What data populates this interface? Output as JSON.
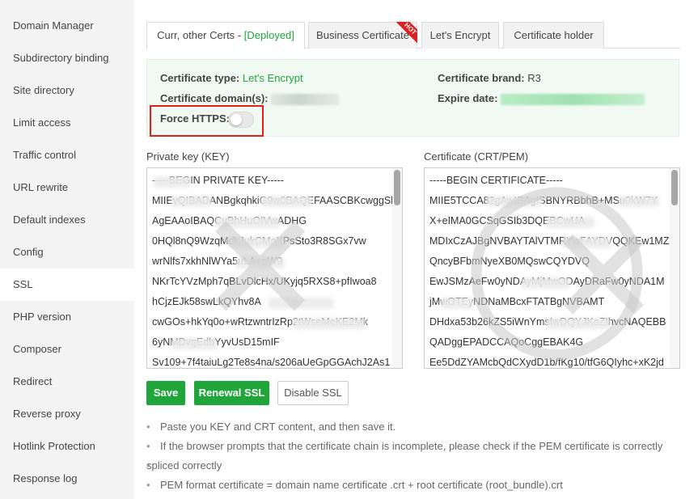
{
  "sidebar": {
    "items": [
      {
        "label": "Domain Manager"
      },
      {
        "label": "Subdirectory binding"
      },
      {
        "label": "Site directory"
      },
      {
        "label": "Limit access"
      },
      {
        "label": "Traffic control"
      },
      {
        "label": "URL rewrite"
      },
      {
        "label": "Default indexes"
      },
      {
        "label": "Config"
      },
      {
        "label": "SSL"
      },
      {
        "label": "PHP version"
      },
      {
        "label": "Composer"
      },
      {
        "label": "Redirect"
      },
      {
        "label": "Reverse proxy"
      },
      {
        "label": "Hotlink Protection"
      },
      {
        "label": "Response log"
      }
    ],
    "active_label": "SSL"
  },
  "tabs": {
    "current_label": "Curr, other Certs - ",
    "current_status": "[Deployed]",
    "business_label": "Business Certificate",
    "business_badge": "HOT",
    "letsencrypt_label": "Let's Encrypt",
    "holder_label": "Certificate holder"
  },
  "cert_info": {
    "type_label": "Certificate type:",
    "type_value": "Let's Encrypt",
    "brand_label": "Certificate brand:",
    "brand_value": "R3",
    "domain_label": "Certificate domain(s):",
    "expire_label": "Expire date:",
    "force_https_label": "Force HTTPS:",
    "force_https_enabled": false
  },
  "private_key": {
    "label": "Private key (KEY)",
    "lines": [
      "-----BEGIN PRIVATE KEY-----",
      "MIIEvQIBADANBgkqhkiG9w0BAQEFAASCBKcwggSl",
      "AgEAAoIBAQCuBhHuOIVwADHG",
      "0HQl8nQ9WzqMdkJukCMoXPsSto3R8SGx7vw",
      "wrNlfs7xkhNlWYa5uLA+pW9",
      "NKrTcYVzMph7qBLvDlcHx/UKyjq5RXS8+pfIwoa8",
      "hCjzEJk58swLkQYhv8A",
      "cwGOs+hkYq0o+wRtzwntrIzRp2tWseMeKE2Mk",
      "6yNMDvqEdbYyvUsD15mIF",
      "Sv109+7f4taiuLg2Te8s4na/s206aUeGpGGAchJ2As1"
    ]
  },
  "certificate": {
    "label": "Certificate (CRT/PEM)",
    "lines": [
      "-----BEGIN CERTIFICATE-----",
      "MIIE5TCCA82gAwIBAgISBNYRBbhB+MSu0kW7Y",
      "X+eIMA0GCSqGSIb3DQEBCwUA",
      "MDIxCzAJBgNVBAYTAlVTMRYwFAYDVQQKEw1MZX",
      "QncyBFbmNyeXB0MQswCQYDVQ",
      "EwJSMzAeFw0yNDAyMjMwODAyDRaFw0yNDA1M",
      "jMwOTEyNDNaMBcxFTATBgNVBAMT",
      "DHdxa53b26kZS5iWnYmsIwDQYJKoZIhvcNAQEBB",
      "QADggEPADCCAQoCggEBAK4G",
      "Ee5DdZYAMcbQdCXydD1b/fKg10/tfG6QIyhc+xK2jd"
    ]
  },
  "buttons": {
    "save": "Save",
    "renew": "Renewal SSL",
    "disable": "Disable SSL"
  },
  "notes": {
    "n1": "Paste you KEY and CRT content, and then save it.",
    "n2a": "If the browser prompts that the certificate chain is incomplete, please check if the PEM certificate is correctly",
    "n2b": "spliced correctly",
    "n3": "PEM format certificate = domain name certificate .crt + root certificate (root_bundle).crt"
  },
  "colors": {
    "accent": "#20a53a",
    "highlight_border": "#e0201a",
    "info_bg": "#f1f9f3",
    "sidebar_bg": "#f4f4f4"
  }
}
